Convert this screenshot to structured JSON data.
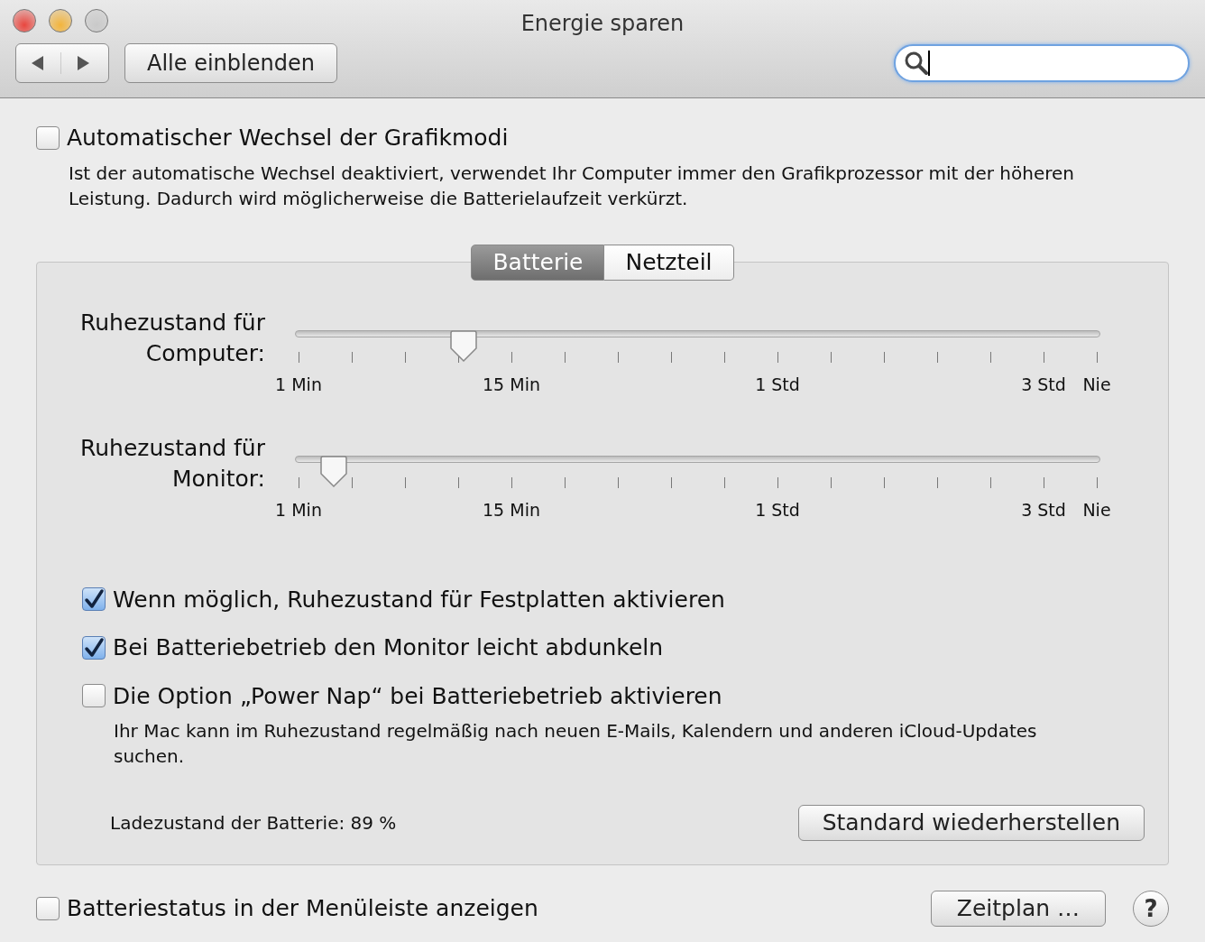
{
  "window": {
    "title": "Energie sparen"
  },
  "toolbar": {
    "show_all": "Alle einblenden"
  },
  "graphics_switch": {
    "label": "Automatischer Wechsel der Grafikmodi",
    "checked": false,
    "description": "Ist der automatische Wechsel deaktiviert, verwendet Ihr Computer immer den Grafikprozessor mit der höheren Leistung. Dadurch wird möglicherweise die Batterielaufzeit verkürzt."
  },
  "tabs": [
    {
      "label": "Batterie",
      "selected": true
    },
    {
      "label": "Netzteil",
      "selected": false
    }
  ],
  "sliders": [
    {
      "label": "Ruhezustand für Computer:",
      "level": 0.209,
      "scale": [
        {
          "kind": "labeled",
          "label": "1 Min"
        },
        {
          "kind": "tick"
        },
        {
          "kind": "tick"
        },
        {
          "kind": "tick"
        },
        {
          "kind": "labeled",
          "label": "15 Min"
        },
        {
          "kind": "tick"
        },
        {
          "kind": "tick"
        },
        {
          "kind": "tick"
        },
        {
          "kind": "tick"
        },
        {
          "kind": "labeled",
          "label": "1 Std"
        },
        {
          "kind": "tick"
        },
        {
          "kind": "tick"
        },
        {
          "kind": "tick"
        },
        {
          "kind": "tick"
        },
        {
          "kind": "labeled",
          "label": "3 Std"
        },
        {
          "kind": "labeled",
          "label": "Nie"
        }
      ]
    },
    {
      "label": "Ruhezustand für Monitor:",
      "level": 0.048,
      "scale": [
        {
          "kind": "labeled",
          "label": "1 Min"
        },
        {
          "kind": "tick"
        },
        {
          "kind": "tick"
        },
        {
          "kind": "tick"
        },
        {
          "kind": "labeled",
          "label": "15 Min"
        },
        {
          "kind": "tick"
        },
        {
          "kind": "tick"
        },
        {
          "kind": "tick"
        },
        {
          "kind": "tick"
        },
        {
          "kind": "labeled",
          "label": "1 Std"
        },
        {
          "kind": "tick"
        },
        {
          "kind": "tick"
        },
        {
          "kind": "tick"
        },
        {
          "kind": "tick"
        },
        {
          "kind": "labeled",
          "label": "3 Std"
        },
        {
          "kind": "labeled",
          "label": "Nie"
        }
      ]
    }
  ],
  "options": [
    {
      "label": "Wenn möglich, Ruhezustand für Festplatten aktivieren",
      "checked": true
    },
    {
      "label": "Bei Batteriebetrieb den Monitor leicht abdunkeln",
      "checked": true
    },
    {
      "label": "Die Option „Power Nap“ bei Batteriebetrieb aktivieren",
      "checked": false,
      "description": "Ihr Mac kann im Ruhezustand regelmäßig nach neuen E-Mails, Kalendern und anderen iCloud-Updates suchen."
    }
  ],
  "battery_level": "Ladezustand der Batterie: 89 %",
  "restore_button": "Standard wiederherstellen",
  "menu_bar_status": {
    "label": "Batteriestatus in der Menüleiste anzeigen",
    "checked": false
  },
  "schedule_button": "Zeitplan …",
  "help_button": "?"
}
